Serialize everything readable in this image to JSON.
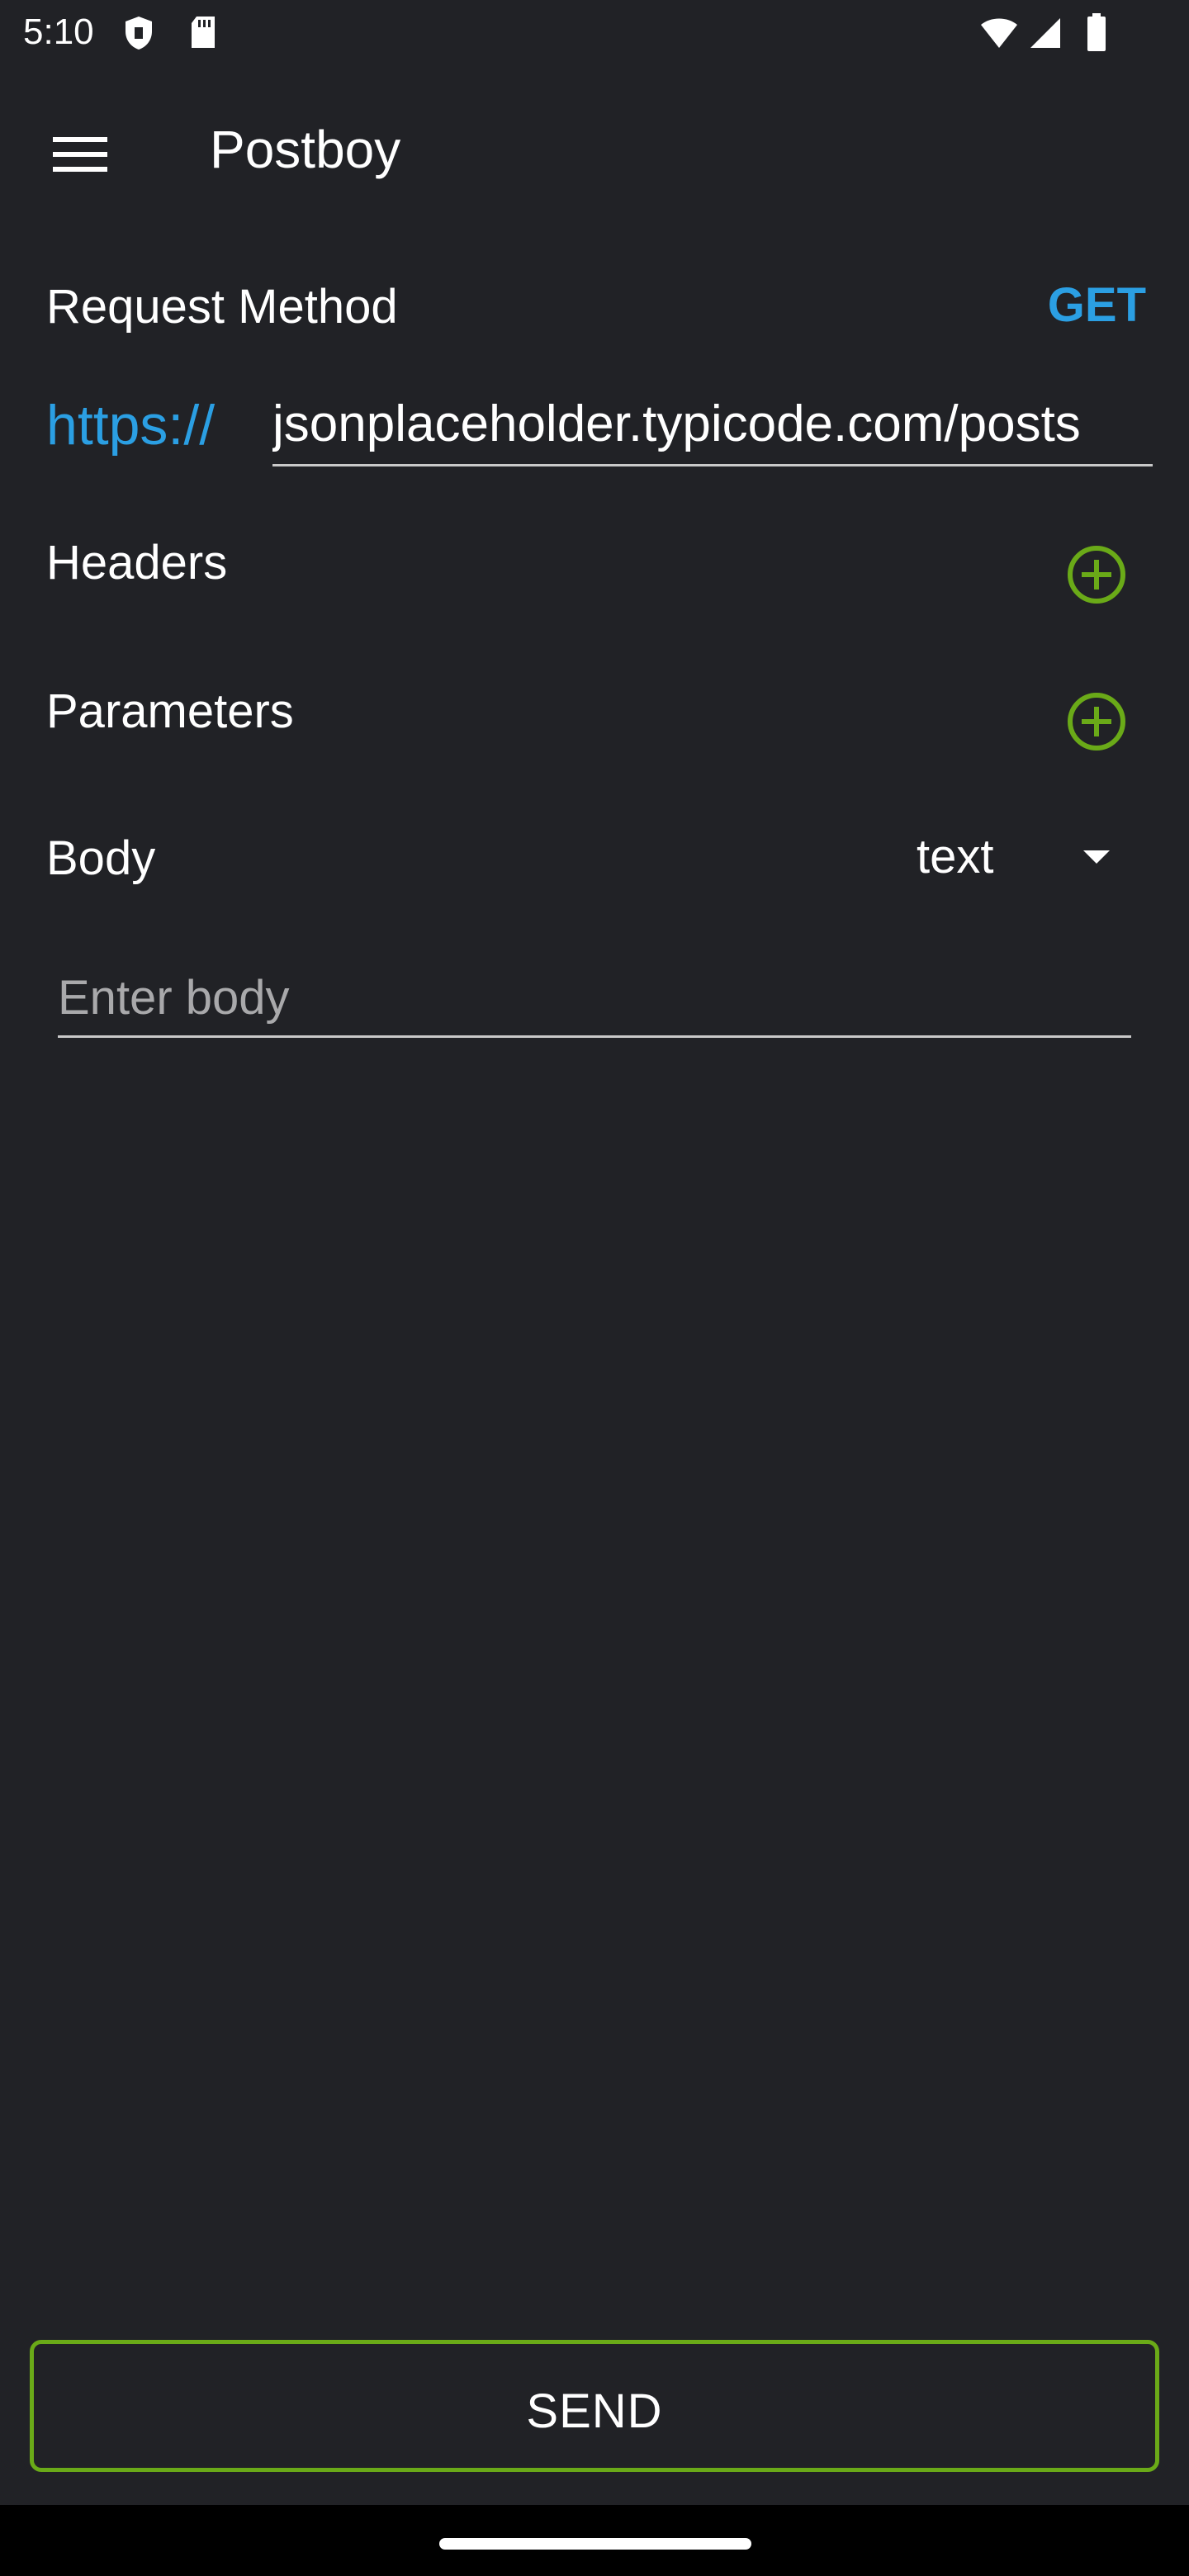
{
  "status_bar": {
    "time": "5:10",
    "icons": [
      "shield-icon",
      "sd-card-icon",
      "wifi-icon",
      "cell-signal-icon",
      "battery-icon"
    ]
  },
  "app_bar": {
    "menu_icon": "menu-icon",
    "title": "Postboy"
  },
  "request": {
    "method_label": "Request Method",
    "method_value": "GET",
    "protocol": "https://",
    "url": "jsonplaceholder.typicode.com/posts"
  },
  "headers": {
    "label": "Headers",
    "add_icon": "add-circle-icon"
  },
  "parameters": {
    "label": "Parameters",
    "add_icon": "add-circle-icon"
  },
  "body": {
    "label": "Body",
    "type_value": "text",
    "placeholder": "Enter body",
    "value": ""
  },
  "send": {
    "label": "SEND"
  },
  "colors": {
    "background": "#212226",
    "accent_blue": "#2b9fe3",
    "accent_green": "#6aaa18",
    "nav_bar": "#000000"
  }
}
